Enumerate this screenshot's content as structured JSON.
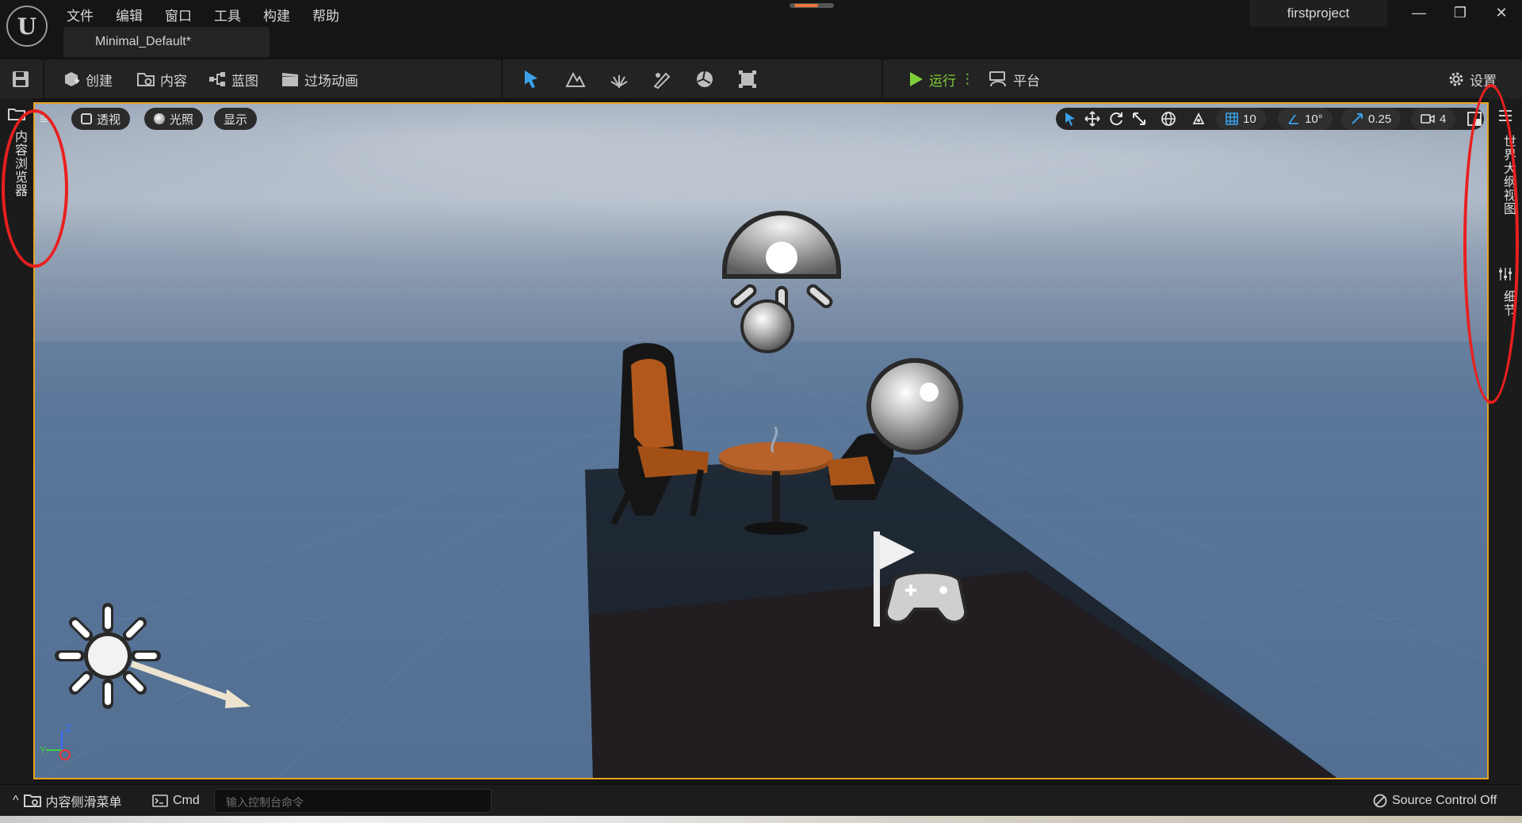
{
  "menu": {
    "items": [
      "文件",
      "编辑",
      "窗口",
      "工具",
      "构建",
      "帮助"
    ]
  },
  "document_tab": "Minimal_Default*",
  "project_name": "firstproject",
  "window_controls": {
    "minimize": "—",
    "restore": "❐",
    "close": "✕"
  },
  "toolbar": {
    "create": "创建",
    "content": "内容",
    "blueprint": "蓝图",
    "cinematics": "过场动画",
    "run": "运行",
    "run_more": "⋮",
    "platform": "平台",
    "settings": "设置"
  },
  "left_panel": {
    "content_browser_tab": "内容浏览器"
  },
  "right_panel": {
    "outliner_tab": "世界大纲视图",
    "details_tab": "细节"
  },
  "viewport": {
    "menu_glyph": "≡",
    "perspective": "透视",
    "lighting": "光照",
    "show": "显示",
    "grid_snap": "10",
    "rotation_snap": "10°",
    "scale_snap": "0.25",
    "camera_speed": "4",
    "axis_z": "Z",
    "axis_y": "Y"
  },
  "bottom_bar": {
    "collapse_glyph": "^",
    "content_drawer": "内容侧滑菜单",
    "cmd": "Cmd",
    "cmd_placeholder": "输入控制台命令",
    "source_control": "Source Control Off"
  },
  "colors": {
    "accent_orange": "#e8a21f",
    "run_green": "#7fcf3a",
    "annotation_red": "#e8201f",
    "mode_blue": "#3aa0e8"
  }
}
